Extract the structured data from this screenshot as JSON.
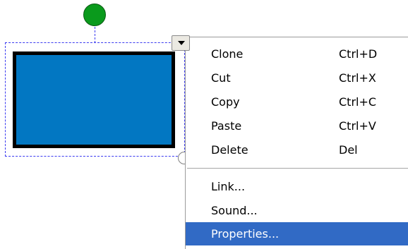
{
  "shape": {
    "fill_color": "#0277c2",
    "stroke_color": "#000000",
    "rotate_handle_color": "#0a9a1c"
  },
  "context_menu": {
    "items": [
      {
        "label": "Clone",
        "shortcut": "Ctrl+D"
      },
      {
        "label": "Cut",
        "shortcut": "Ctrl+X"
      },
      {
        "label": "Copy",
        "shortcut": "Ctrl+C"
      },
      {
        "label": "Paste",
        "shortcut": "Ctrl+V"
      },
      {
        "label": "Delete",
        "shortcut": "Del"
      },
      {
        "label": "Link..."
      },
      {
        "label": "Sound..."
      },
      {
        "label": "Properties...",
        "selected": true
      }
    ],
    "highlight_color": "#316ac5"
  },
  "icons": {
    "menu_trigger": "dropdown-arrow-icon",
    "rotate": "rotate-handle-icon",
    "resize": "resize-handle-icon"
  }
}
